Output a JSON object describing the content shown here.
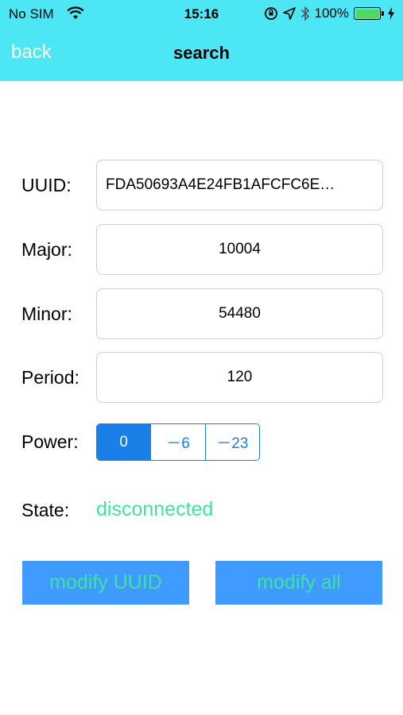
{
  "status_bar": {
    "carrier": "No SIM",
    "time": "15:16",
    "battery_percent": "100%",
    "icons": [
      "wifi-icon",
      "orientation-lock-icon",
      "location-icon",
      "bluetooth-icon",
      "battery-icon",
      "charging-icon"
    ]
  },
  "nav": {
    "back_label": "back",
    "title": "search"
  },
  "form": {
    "uuid_label": "UUID:",
    "uuid_value": "FDA50693A4E24FB1AFCFC6E…",
    "major_label": "Major:",
    "major_value": "10004",
    "minor_label": "Minor:",
    "minor_value": "54480",
    "period_label": "Period:",
    "period_value": "120",
    "power_label": "Power:",
    "power_options": [
      "0",
      "－6",
      "－23"
    ],
    "power_selected": "0",
    "state_label": "State:",
    "state_value": "disconnected"
  },
  "actions": {
    "modify_uuid_label": "modify UUID",
    "modify_all_label": "modify all"
  },
  "colors": {
    "header": "#4ce6f5",
    "accent_blue": "#1a7fe6",
    "button_bg": "#3f9bff",
    "green_text": "#3ee3a1",
    "battery_fill": "#4cd964"
  }
}
